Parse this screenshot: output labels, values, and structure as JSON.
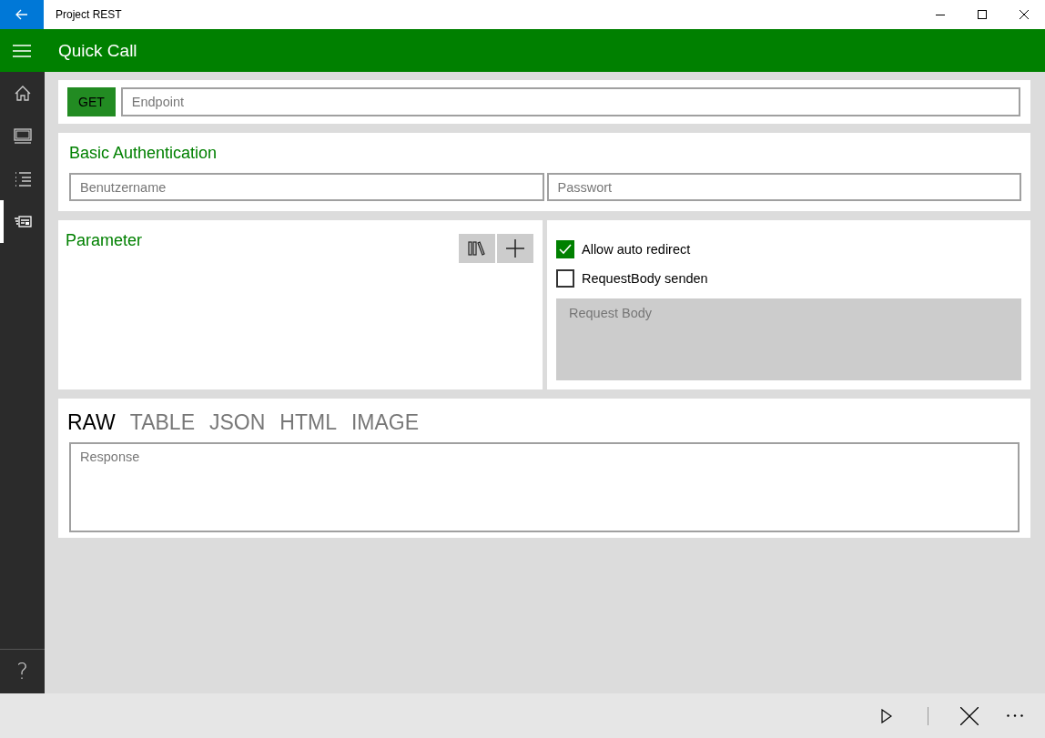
{
  "window": {
    "title": "Project REST"
  },
  "header": {
    "title": "Quick Call"
  },
  "nav": {
    "items": [
      {
        "kind": "home",
        "selected": false
      },
      {
        "kind": "monitor",
        "selected": false
      },
      {
        "kind": "list",
        "selected": false
      },
      {
        "kind": "form",
        "selected": true
      }
    ],
    "help": "?"
  },
  "request": {
    "method": "GET",
    "endpoint": {
      "placeholder": "Endpoint"
    }
  },
  "auth": {
    "title": "Basic Authentication",
    "username": {
      "placeholder": "Benutzername"
    },
    "password": {
      "placeholder": "Passwort"
    }
  },
  "parameters": {
    "title": "Parameter"
  },
  "options": [
    {
      "label": "Allow auto redirect",
      "checked": true
    },
    {
      "label": "RequestBody senden",
      "checked": false
    }
  ],
  "request_body": {
    "placeholder": "Request Body",
    "disabled": true
  },
  "response": {
    "tabs": [
      {
        "label": "RAW",
        "selected": true
      },
      {
        "label": "TABLE",
        "selected": false
      },
      {
        "label": "JSON",
        "selected": false
      },
      {
        "label": "HTML",
        "selected": false
      },
      {
        "label": "IMAGE",
        "selected": false
      }
    ],
    "body": {
      "placeholder": "Response"
    }
  }
}
